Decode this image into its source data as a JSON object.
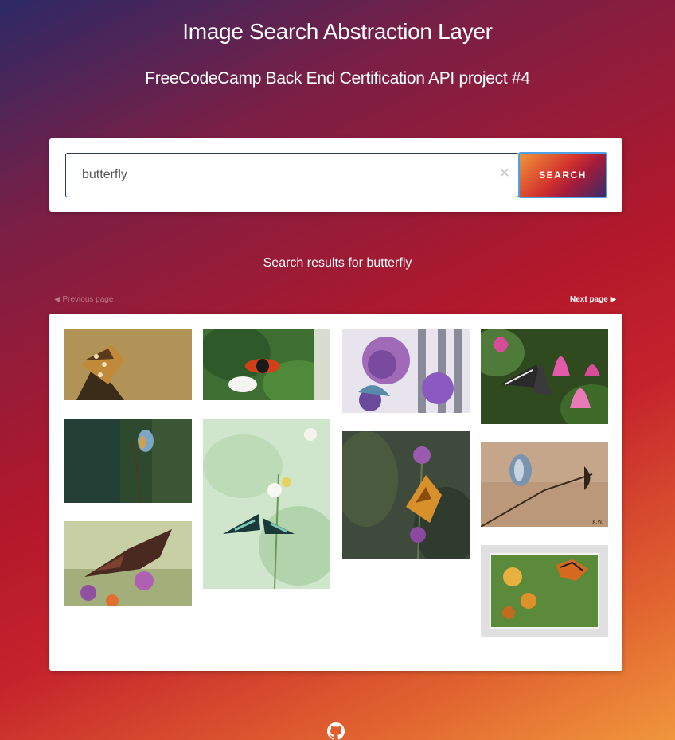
{
  "header": {
    "title": "Image Search Abstraction Layer",
    "subtitle": "FreeCodeCamp Back End Certification API project #4"
  },
  "search": {
    "value": "butterfly",
    "clear_icon": "✕",
    "button_label": "SEARCH"
  },
  "results": {
    "heading": "Search results for butterfly",
    "prev_label": "◀ Previous page",
    "next_label": "Next page ▶",
    "images": [
      {
        "subject": "butterfly on branch, tan background"
      },
      {
        "subject": "orange butterfly on leaves"
      },
      {
        "subject": "purple flowers"
      },
      {
        "subject": "butterfly on pink flower"
      },
      {
        "subject": "blue butterfly on stem"
      },
      {
        "subject": "green butterfly on white flower"
      },
      {
        "subject": "orange comma butterfly on thistle"
      },
      {
        "subject": "blue butterfly on grass seed"
      },
      {
        "subject": "brown butterfly on purple flower"
      },
      {
        "subject": "monarch butterfly framed painting"
      }
    ]
  },
  "footer": {
    "icon": "github-icon"
  }
}
